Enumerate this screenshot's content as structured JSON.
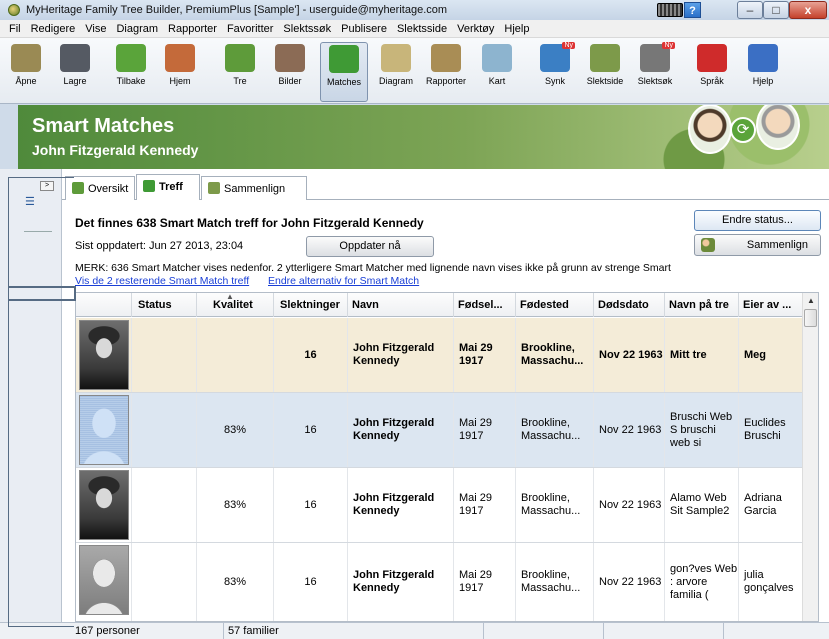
{
  "window": {
    "title": "MyHeritage Family Tree Builder, PremiumPlus [Sample'] - userguide@myheritage.com",
    "help": "?",
    "min": "–",
    "max": "□",
    "close": "x"
  },
  "menu": [
    "Fil",
    "Redigere",
    "Vise",
    "Diagram",
    "Rapporter",
    "Favoritter",
    "Slektssøk",
    "Publisere",
    "Slektsside",
    "Verktøy",
    "Hjelp"
  ],
  "toolbar": [
    {
      "label": "Åpne",
      "icon": "open-folder-icon",
      "color": "#9a8a54"
    },
    {
      "label": "Lagre",
      "icon": "save-disk-icon",
      "color": "#555a63"
    },
    {
      "label": "Tilbake",
      "icon": "back-arrow-icon",
      "color": "#5aa43a"
    },
    {
      "label": "Hjem",
      "icon": "home-icon",
      "color": "#c46a3a"
    },
    {
      "label": "Tre",
      "icon": "tree-icon",
      "color": "#5e9b3a"
    },
    {
      "label": "Bilder",
      "icon": "photos-icon",
      "color": "#8b6b55"
    },
    {
      "label": "Matches",
      "icon": "matches-icon",
      "color": "#3f9a35"
    },
    {
      "label": "Diagram",
      "icon": "diagram-icon",
      "color": "#c8b57a"
    },
    {
      "label": "Rapporter",
      "icon": "reports-icon",
      "color": "#a98d55"
    },
    {
      "label": "Kart",
      "icon": "map-icon",
      "color": "#8db4cf"
    },
    {
      "label": "Synk",
      "icon": "sync-icon",
      "color": "#3b7fc4",
      "badge": "Ny"
    },
    {
      "label": "Slektside",
      "icon": "family-site-icon",
      "color": "#7d9a4a"
    },
    {
      "label": "Slektsøk",
      "icon": "search-people-icon",
      "color": "#777",
      "badge": "Ny"
    },
    {
      "label": "Språk",
      "icon": "language-flag-icon",
      "color": "#cf2b2b"
    },
    {
      "label": "Hjelp",
      "icon": "help-icon",
      "color": "#3b6fc4"
    }
  ],
  "banner": {
    "title": "Smart Matches",
    "subtitle": "John Fitzgerald Kennedy"
  },
  "tabs": [
    {
      "label": "Oversikt",
      "color": "#5e9b3a"
    },
    {
      "label": "Treff",
      "color": "#3f9a35"
    },
    {
      "label": "Sammenlign",
      "color": "#7d9a4a"
    }
  ],
  "content": {
    "count_title": "Det finnes 638 Smart Match treff for John Fitzgerald Kennedy",
    "last_updated": "Sist oppdatert: Jun 27 2013, 23:04",
    "refresh_label": "Oppdater nå",
    "change_status_label": "Endre status...",
    "compare_label": "Sammenlign",
    "note": "MERK: 636 Smart Matcher vises nedenfor. 2 ytterligere Smart Matcher med lignende navn vises ikke på grunn av strenge Smart",
    "link_remaining": "Vis de 2 resterende Smart Match treff",
    "link_alternatives": "Endre alternativ for Smart Match"
  },
  "grid": {
    "columns": [
      "Status",
      "Kvalitet",
      "Slektninger",
      "Navn",
      "Fødsel...",
      "Fødested",
      "Dødsdato",
      "Navn på tre",
      "Eier av ..."
    ],
    "rows": [
      {
        "photo": "jfk",
        "status": "",
        "quality": "",
        "relatives": "16",
        "name": "John Fitzgerald Kennedy",
        "birth": "Mai 29 1917",
        "place": "Brookline, Massachu...",
        "death": "Nov 22 1963",
        "tree": "Mitt tre",
        "owner": "Meg"
      },
      {
        "photo": "blue",
        "status": "",
        "quality": "83%",
        "relatives": "16",
        "name": "John Fitzgerald Kennedy",
        "birth": "Mai 29 1917",
        "place": "Brookline, Massachu...",
        "death": "Nov 22 1963",
        "tree": "Bruschi Web S bruschi web si",
        "owner": "Euclides Bruschi"
      },
      {
        "photo": "jfk",
        "status": "",
        "quality": "83%",
        "relatives": "16",
        "name": "John Fitzgerald Kennedy",
        "birth": "Mai 29 1917",
        "place": "Brookline, Massachu...",
        "death": "Nov 22 1963",
        "tree": "Alamo Web Sit Sample2",
        "owner": "Adriana Garcia"
      },
      {
        "photo": "gray",
        "status": "",
        "quality": "83%",
        "relatives": "16",
        "name": "John Fitzgerald Kennedy",
        "birth": "Mai 29 1917",
        "place": "Brookline, Massachu...",
        "death": "Nov 22 1963",
        "tree": "gon?ves Web : arvore familia (",
        "owner": "julia gonçalves"
      }
    ]
  },
  "status": {
    "persons": "167 personer",
    "families": "57 familier"
  }
}
